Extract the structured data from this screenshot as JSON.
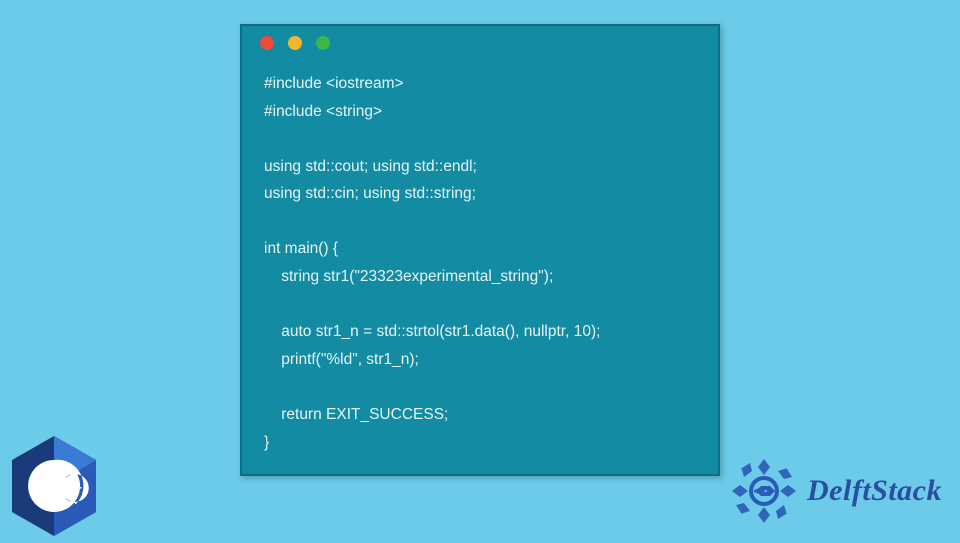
{
  "code": {
    "lines": [
      "#include <iostream>",
      "#include <string>",
      "",
      "using std::cout; using std::endl;",
      "using std::cin; using std::string;",
      "",
      "int main() {",
      "    string str1(\"23323experimental_string\");",
      "",
      "    auto str1_n = std::strtol(str1.data(), nullptr, 10);",
      "    printf(\"%ld\", str1_n);",
      "",
      "    return EXIT_SUCCESS;",
      "}"
    ]
  },
  "window": {
    "dots": [
      "red",
      "yellow",
      "green"
    ]
  },
  "brand": {
    "name": "DelftStack",
    "language_badge": "C++"
  }
}
